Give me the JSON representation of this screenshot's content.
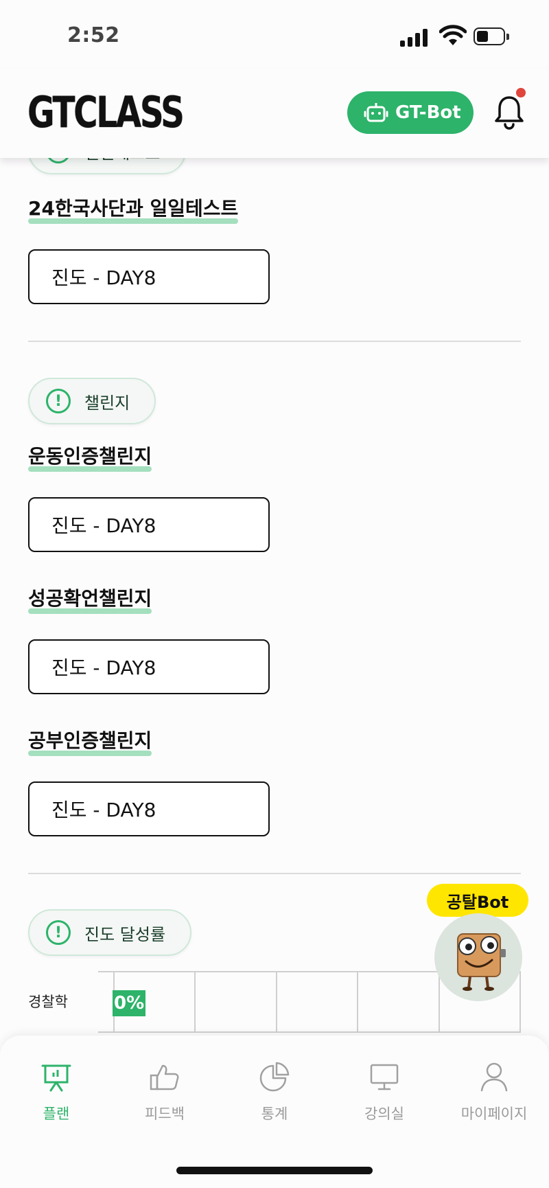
{
  "status": {
    "time": "2:52"
  },
  "header": {
    "logo": "GTCLASS",
    "gtbot_label": "GT-Bot"
  },
  "sections": {
    "daily_test": {
      "chip_label": "일일테스트",
      "title": "24한국사단과 일일테스트",
      "progress": "진도 - DAY8"
    },
    "challenge": {
      "chip_label": "챌린지",
      "items": [
        {
          "title": "운동인증챌린지",
          "progress": "진도 - DAY8"
        },
        {
          "title": "성공확언챌린지",
          "progress": "진도 - DAY8"
        },
        {
          "title": "공부인증챌린지",
          "progress": "진도 - DAY8"
        }
      ]
    },
    "achievement": {
      "chip_label": "진도 달성률",
      "row_label": "경찰학",
      "bar_value_label": "0%"
    }
  },
  "chart_data": {
    "type": "bar",
    "categories": [
      "경찰학"
    ],
    "values": [
      0
    ],
    "title": "진도 달성률",
    "xlabel": "",
    "ylabel": "",
    "xlim": [
      0,
      100
    ]
  },
  "bot": {
    "bubble_label": "공탈Bot"
  },
  "bottom_nav": {
    "items": [
      {
        "label": "플랜",
        "icon": "presentation-chart-icon",
        "active": true
      },
      {
        "label": "피드백",
        "icon": "thumbs-up-icon",
        "active": false
      },
      {
        "label": "통계",
        "icon": "pie-chart-icon",
        "active": false
      },
      {
        "label": "강의실",
        "icon": "monitor-icon",
        "active": false
      },
      {
        "label": "마이페이지",
        "icon": "user-icon",
        "active": false
      }
    ]
  },
  "colors": {
    "accent": "#2db36a",
    "underline": "#a4dfbe",
    "bot_bubble": "#ffe600",
    "notification": "#e0453b"
  }
}
